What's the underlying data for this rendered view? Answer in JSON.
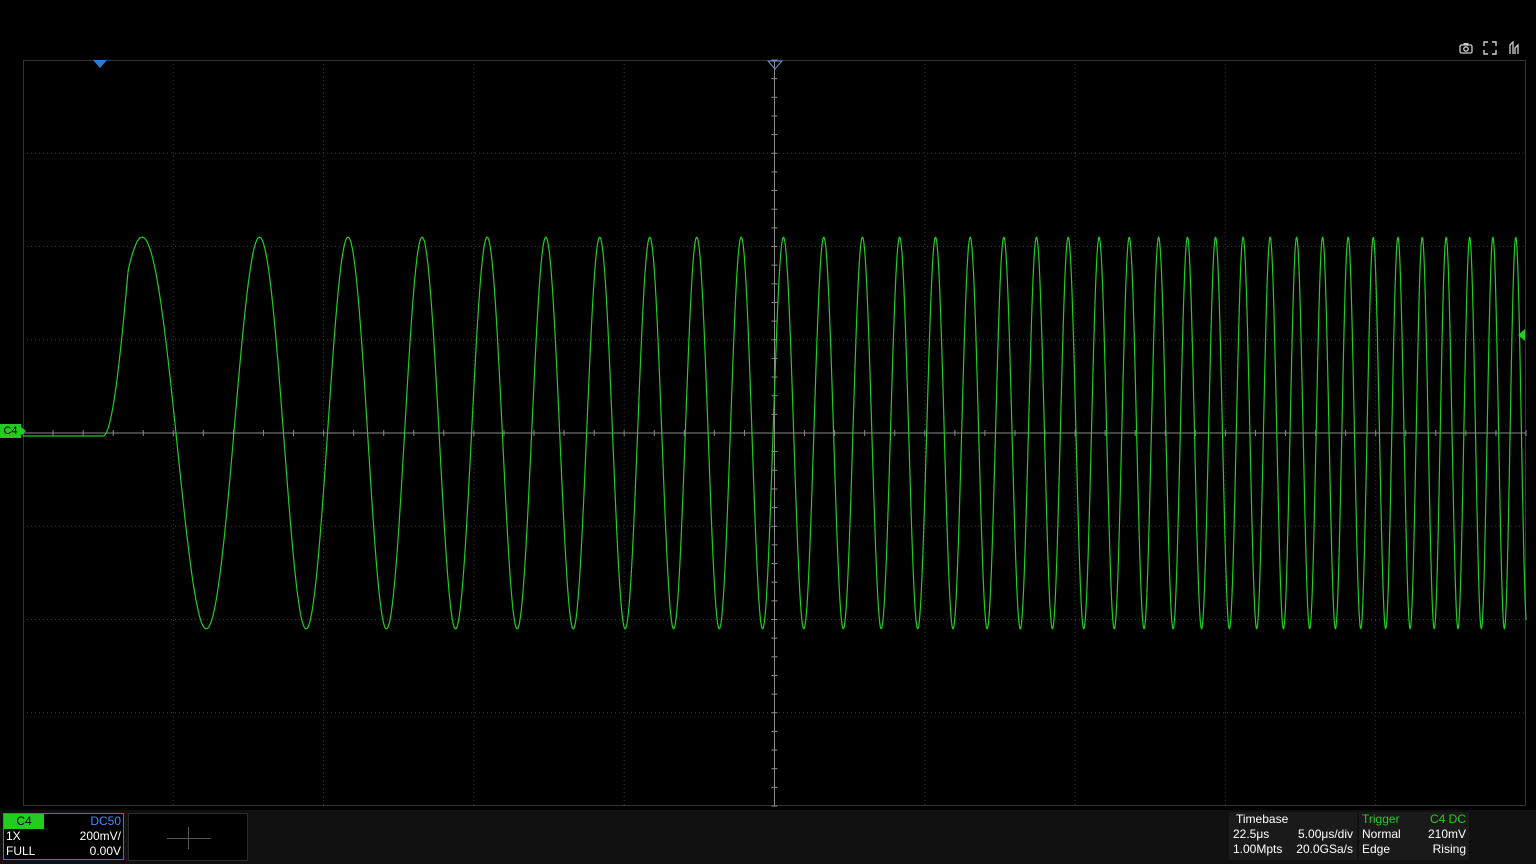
{
  "toolbar": {
    "icons": [
      "camera-icon",
      "fullscreen-icon",
      "menu-toggle-icon"
    ]
  },
  "display": {
    "grid_divisions": {
      "horizontal": 10,
      "vertical": 8
    },
    "trace_color": "#22cc22",
    "grid_color": "#3a3a3a",
    "marker_color": "#2e7bd6"
  },
  "channel": {
    "name": "C4",
    "coupling": "DC50",
    "probe": "1X",
    "scale": "200mV/",
    "bandwidth": "FULL",
    "offset": "0.00V"
  },
  "timebase": {
    "title": "Timebase",
    "delay": "22.5μs",
    "scale": "5.00μs/div",
    "memory_depth": "1.00Mpts",
    "sample_rate": "20.0GSa/s"
  },
  "trigger": {
    "title": "Trigger",
    "source": "C4 DC",
    "mode": "Normal",
    "level": "210mV",
    "type": "Edge",
    "slope": "Rising"
  },
  "waveform": {
    "type": "chirp",
    "amplitude_div": 2.1,
    "start_position_div": 0.8,
    "pretrigger_div": 7.5
  }
}
